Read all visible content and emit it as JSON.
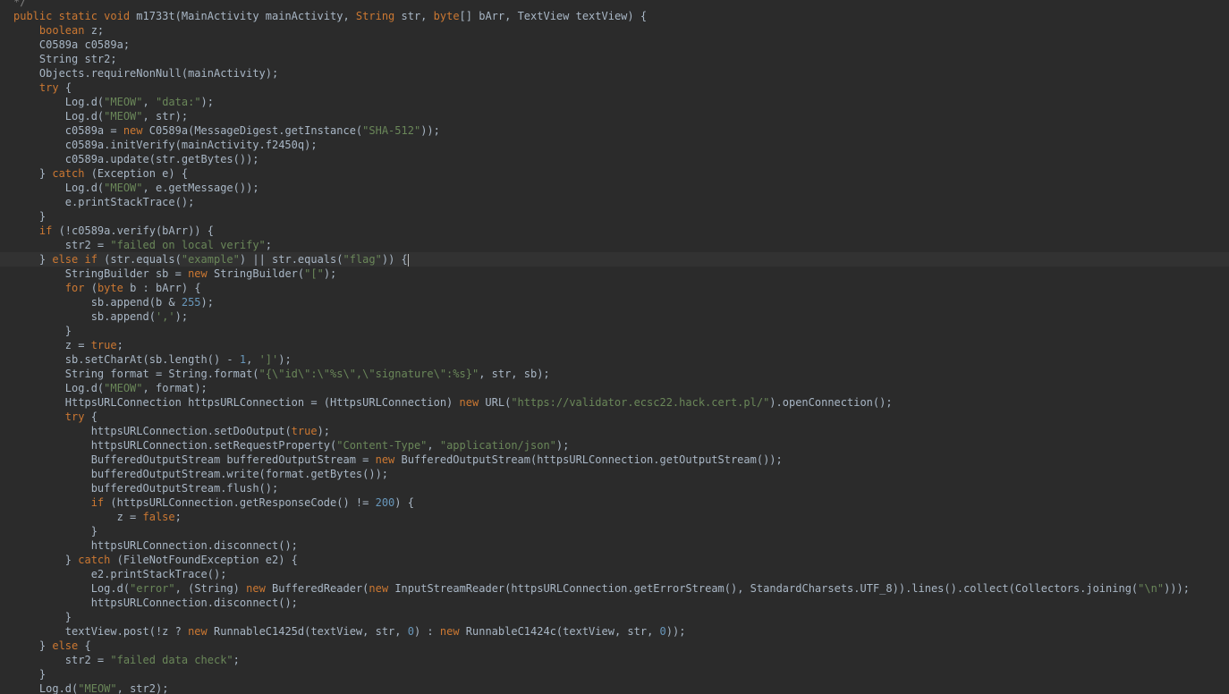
{
  "colors": {
    "background": "#2b2b2b",
    "current_line": "#323232",
    "plain": "#a9b7c6",
    "keyword": "#cc7832",
    "string": "#6a8759",
    "number": "#6897bb",
    "comment": "#808080"
  },
  "lines": [
    {
      "indent": "",
      "tokens": [
        {
          "t": "*/",
          "c": "cm"
        }
      ]
    },
    {
      "indent": "",
      "tokens": [
        {
          "t": "public static void",
          "c": "kw"
        },
        {
          "t": " m1733t(MainActivity mainActivity, ",
          "c": ""
        },
        {
          "t": "String",
          "c": "kw"
        },
        {
          "t": " str, ",
          "c": ""
        },
        {
          "t": "byte",
          "c": "kw"
        },
        {
          "t": "[] bArr, TextView textView) {",
          "c": ""
        }
      ]
    },
    {
      "indent": "    ",
      "tokens": [
        {
          "t": "boolean",
          "c": "kw"
        },
        {
          "t": " z;",
          "c": ""
        }
      ]
    },
    {
      "indent": "    ",
      "tokens": [
        {
          "t": "C0589a c0589a;",
          "c": ""
        }
      ]
    },
    {
      "indent": "    ",
      "tokens": [
        {
          "t": "String str2;",
          "c": ""
        }
      ]
    },
    {
      "indent": "    ",
      "tokens": [
        {
          "t": "Objects.requireNonNull(mainActivity);",
          "c": ""
        }
      ]
    },
    {
      "indent": "    ",
      "tokens": [
        {
          "t": "try",
          "c": "kw"
        },
        {
          "t": " {",
          "c": ""
        }
      ]
    },
    {
      "indent": "        ",
      "tokens": [
        {
          "t": "Log.d(",
          "c": ""
        },
        {
          "t": "\"MEOW\"",
          "c": "str"
        },
        {
          "t": ", ",
          "c": ""
        },
        {
          "t": "\"data:\"",
          "c": "str"
        },
        {
          "t": ");",
          "c": ""
        }
      ]
    },
    {
      "indent": "        ",
      "tokens": [
        {
          "t": "Log.d(",
          "c": ""
        },
        {
          "t": "\"MEOW\"",
          "c": "str"
        },
        {
          "t": ", str);",
          "c": ""
        }
      ]
    },
    {
      "indent": "        ",
      "tokens": [
        {
          "t": "c0589a = ",
          "c": ""
        },
        {
          "t": "new",
          "c": "kw"
        },
        {
          "t": " C0589a(MessageDigest.getInstance(",
          "c": ""
        },
        {
          "t": "\"SHA-512\"",
          "c": "str"
        },
        {
          "t": "));",
          "c": ""
        }
      ]
    },
    {
      "indent": "        ",
      "tokens": [
        {
          "t": "c0589a.initVerify(mainActivity.f2450q);",
          "c": ""
        }
      ]
    },
    {
      "indent": "        ",
      "tokens": [
        {
          "t": "c0589a.update(str.getBytes());",
          "c": ""
        }
      ]
    },
    {
      "indent": "    ",
      "tokens": [
        {
          "t": "} ",
          "c": ""
        },
        {
          "t": "catch",
          "c": "kw"
        },
        {
          "t": " (Exception e) {",
          "c": ""
        }
      ]
    },
    {
      "indent": "        ",
      "tokens": [
        {
          "t": "Log.d(",
          "c": ""
        },
        {
          "t": "\"MEOW\"",
          "c": "str"
        },
        {
          "t": ", e.getMessage());",
          "c": ""
        }
      ]
    },
    {
      "indent": "        ",
      "tokens": [
        {
          "t": "e.printStackTrace();",
          "c": ""
        }
      ]
    },
    {
      "indent": "    ",
      "tokens": [
        {
          "t": "}",
          "c": ""
        }
      ]
    },
    {
      "indent": "    ",
      "tokens": [
        {
          "t": "if",
          "c": "kw"
        },
        {
          "t": " (!c0589a.verify(bArr)) {",
          "c": ""
        }
      ]
    },
    {
      "indent": "        ",
      "tokens": [
        {
          "t": "str2 = ",
          "c": ""
        },
        {
          "t": "\"failed on local verify\"",
          "c": "str"
        },
        {
          "t": ";",
          "c": ""
        }
      ]
    },
    {
      "indent": "    ",
      "current": true,
      "caret": true,
      "tokens": [
        {
          "t": "} ",
          "c": ""
        },
        {
          "t": "else if",
          "c": "kw"
        },
        {
          "t": " (str.equals(",
          "c": ""
        },
        {
          "t": "\"example\"",
          "c": "str"
        },
        {
          "t": ") || str.equals(",
          "c": ""
        },
        {
          "t": "\"flag\"",
          "c": "str"
        },
        {
          "t": ")) {",
          "c": ""
        }
      ]
    },
    {
      "indent": "        ",
      "tokens": [
        {
          "t": "StringBuilder sb = ",
          "c": ""
        },
        {
          "t": "new",
          "c": "kw"
        },
        {
          "t": " StringBuilder(",
          "c": ""
        },
        {
          "t": "\"[\"",
          "c": "str"
        },
        {
          "t": ");",
          "c": ""
        }
      ]
    },
    {
      "indent": "        ",
      "tokens": [
        {
          "t": "for",
          "c": "kw"
        },
        {
          "t": " (",
          "c": ""
        },
        {
          "t": "byte",
          "c": "kw"
        },
        {
          "t": " b : bArr) {",
          "c": ""
        }
      ]
    },
    {
      "indent": "            ",
      "tokens": [
        {
          "t": "sb.append(b & ",
          "c": ""
        },
        {
          "t": "255",
          "c": "num"
        },
        {
          "t": ");",
          "c": ""
        }
      ]
    },
    {
      "indent": "            ",
      "tokens": [
        {
          "t": "sb.append(",
          "c": ""
        },
        {
          "t": "','",
          "c": "str"
        },
        {
          "t": ");",
          "c": ""
        }
      ]
    },
    {
      "indent": "        ",
      "tokens": [
        {
          "t": "}",
          "c": ""
        }
      ]
    },
    {
      "indent": "        ",
      "tokens": [
        {
          "t": "z = ",
          "c": ""
        },
        {
          "t": "true",
          "c": "kw"
        },
        {
          "t": ";",
          "c": ""
        }
      ]
    },
    {
      "indent": "        ",
      "tokens": [
        {
          "t": "sb.setCharAt(sb.length() - ",
          "c": ""
        },
        {
          "t": "1",
          "c": "num"
        },
        {
          "t": ", ",
          "c": ""
        },
        {
          "t": "']'",
          "c": "str"
        },
        {
          "t": ");",
          "c": ""
        }
      ]
    },
    {
      "indent": "        ",
      "tokens": [
        {
          "t": "String format = String.format(",
          "c": ""
        },
        {
          "t": "\"{\\\"id\\\":\\\"%s\\\",\\\"signature\\\":%s}\"",
          "c": "str"
        },
        {
          "t": ", str, sb);",
          "c": ""
        }
      ]
    },
    {
      "indent": "        ",
      "tokens": [
        {
          "t": "Log.d(",
          "c": ""
        },
        {
          "t": "\"MEOW\"",
          "c": "str"
        },
        {
          "t": ", format);",
          "c": ""
        }
      ]
    },
    {
      "indent": "        ",
      "tokens": [
        {
          "t": "HttpsURLConnection httpsURLConnection = (HttpsURLConnection) ",
          "c": ""
        },
        {
          "t": "new",
          "c": "kw"
        },
        {
          "t": " URL(",
          "c": ""
        },
        {
          "t": "\"https://validator.ecsc22.hack.cert.pl/\"",
          "c": "str"
        },
        {
          "t": ").openConnection();",
          "c": ""
        }
      ]
    },
    {
      "indent": "        ",
      "tokens": [
        {
          "t": "try",
          "c": "kw"
        },
        {
          "t": " {",
          "c": ""
        }
      ]
    },
    {
      "indent": "            ",
      "tokens": [
        {
          "t": "httpsURLConnection.setDoOutput(",
          "c": ""
        },
        {
          "t": "true",
          "c": "kw"
        },
        {
          "t": ");",
          "c": ""
        }
      ]
    },
    {
      "indent": "            ",
      "tokens": [
        {
          "t": "httpsURLConnection.setRequestProperty(",
          "c": ""
        },
        {
          "t": "\"Content-Type\"",
          "c": "str"
        },
        {
          "t": ", ",
          "c": ""
        },
        {
          "t": "\"application/json\"",
          "c": "str"
        },
        {
          "t": ");",
          "c": ""
        }
      ]
    },
    {
      "indent": "            ",
      "tokens": [
        {
          "t": "BufferedOutputStream bufferedOutputStream = ",
          "c": ""
        },
        {
          "t": "new",
          "c": "kw"
        },
        {
          "t": " BufferedOutputStream(httpsURLConnection.getOutputStream());",
          "c": ""
        }
      ]
    },
    {
      "indent": "            ",
      "tokens": [
        {
          "t": "bufferedOutputStream.write(format.getBytes());",
          "c": ""
        }
      ]
    },
    {
      "indent": "            ",
      "tokens": [
        {
          "t": "bufferedOutputStream.flush();",
          "c": ""
        }
      ]
    },
    {
      "indent": "            ",
      "tokens": [
        {
          "t": "if",
          "c": "kw"
        },
        {
          "t": " (httpsURLConnection.getResponseCode() != ",
          "c": ""
        },
        {
          "t": "200",
          "c": "num"
        },
        {
          "t": ") {",
          "c": ""
        }
      ]
    },
    {
      "indent": "                ",
      "tokens": [
        {
          "t": "z = ",
          "c": ""
        },
        {
          "t": "false",
          "c": "kw"
        },
        {
          "t": ";",
          "c": ""
        }
      ]
    },
    {
      "indent": "            ",
      "tokens": [
        {
          "t": "}",
          "c": ""
        }
      ]
    },
    {
      "indent": "            ",
      "tokens": [
        {
          "t": "httpsURLConnection.disconnect();",
          "c": ""
        }
      ]
    },
    {
      "indent": "        ",
      "tokens": [
        {
          "t": "} ",
          "c": ""
        },
        {
          "t": "catch",
          "c": "kw"
        },
        {
          "t": " (FileNotFoundException e2) {",
          "c": ""
        }
      ]
    },
    {
      "indent": "            ",
      "tokens": [
        {
          "t": "e2.printStackTrace();",
          "c": ""
        }
      ]
    },
    {
      "indent": "            ",
      "tokens": [
        {
          "t": "Log.d(",
          "c": ""
        },
        {
          "t": "\"error\"",
          "c": "str"
        },
        {
          "t": ", (String) ",
          "c": ""
        },
        {
          "t": "new",
          "c": "kw"
        },
        {
          "t": " BufferedReader(",
          "c": ""
        },
        {
          "t": "new",
          "c": "kw"
        },
        {
          "t": " InputStreamReader(httpsURLConnection.getErrorStream(), StandardCharsets.UTF_8)).lines().collect(Collectors.joining(",
          "c": ""
        },
        {
          "t": "\"\\n\"",
          "c": "str"
        },
        {
          "t": ")));",
          "c": ""
        }
      ]
    },
    {
      "indent": "            ",
      "tokens": [
        {
          "t": "httpsURLConnection.disconnect();",
          "c": ""
        }
      ]
    },
    {
      "indent": "        ",
      "tokens": [
        {
          "t": "}",
          "c": ""
        }
      ]
    },
    {
      "indent": "        ",
      "tokens": [
        {
          "t": "textView.post(!z ? ",
          "c": ""
        },
        {
          "t": "new",
          "c": "kw"
        },
        {
          "t": " RunnableC1425d(textView, str, ",
          "c": ""
        },
        {
          "t": "0",
          "c": "num"
        },
        {
          "t": ") : ",
          "c": ""
        },
        {
          "t": "new",
          "c": "kw"
        },
        {
          "t": " RunnableC1424c(textView, str, ",
          "c": ""
        },
        {
          "t": "0",
          "c": "num"
        },
        {
          "t": "));",
          "c": ""
        }
      ]
    },
    {
      "indent": "    ",
      "tokens": [
        {
          "t": "} ",
          "c": ""
        },
        {
          "t": "else",
          "c": "kw"
        },
        {
          "t": " {",
          "c": ""
        }
      ]
    },
    {
      "indent": "        ",
      "tokens": [
        {
          "t": "str2 = ",
          "c": ""
        },
        {
          "t": "\"failed data check\"",
          "c": "str"
        },
        {
          "t": ";",
          "c": ""
        }
      ]
    },
    {
      "indent": "    ",
      "tokens": [
        {
          "t": "}",
          "c": ""
        }
      ]
    },
    {
      "indent": "    ",
      "tokens": [
        {
          "t": "Log.d(",
          "c": ""
        },
        {
          "t": "\"MEOW\"",
          "c": "str"
        },
        {
          "t": ", str2);",
          "c": ""
        }
      ]
    }
  ]
}
